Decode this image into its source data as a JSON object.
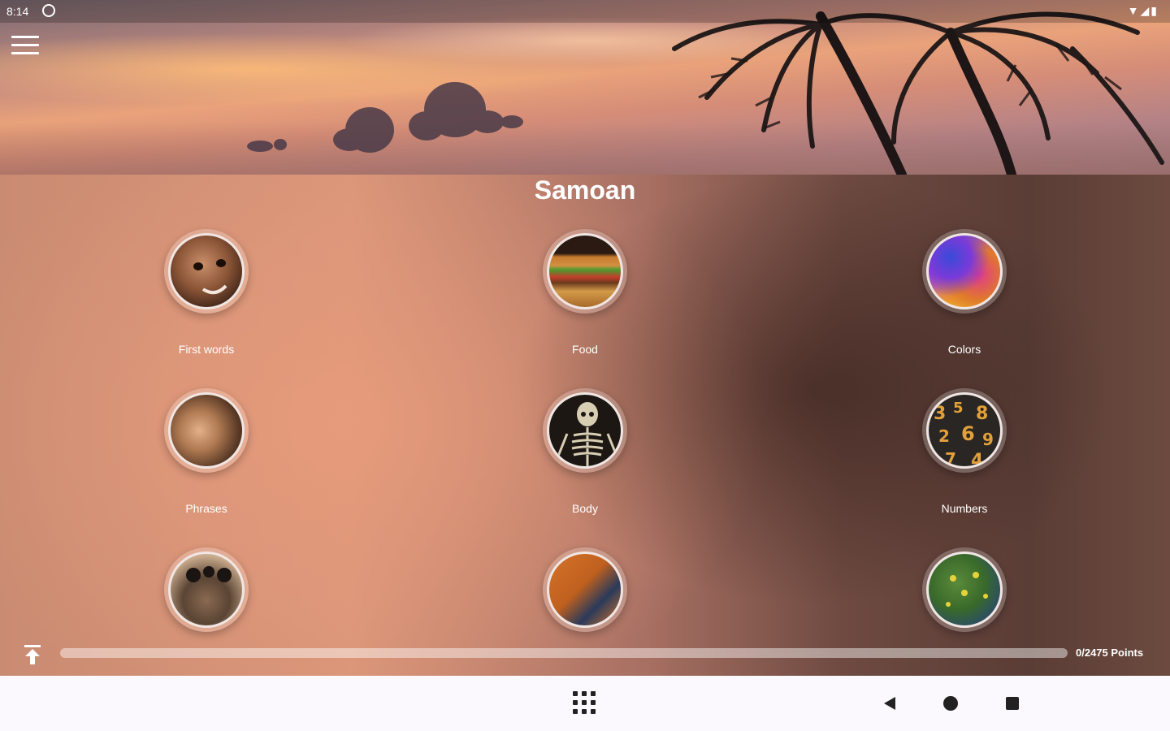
{
  "status_bar": {
    "time": "8:14",
    "icons": [
      "wifi-icon",
      "signal-icon",
      "battery-icon"
    ]
  },
  "header": {
    "menu_icon": "hamburger-menu-icon"
  },
  "title": "Samoan",
  "categories": [
    {
      "label": "First words",
      "icon": "baby-face-photo"
    },
    {
      "label": "Food",
      "icon": "burger-photo"
    },
    {
      "label": "Colors",
      "icon": "color-powder-photo"
    },
    {
      "label": "Phrases",
      "icon": "woman-photo"
    },
    {
      "label": "Body",
      "icon": "skeleton-photo"
    },
    {
      "label": "Numbers",
      "icon": "numbers-photo"
    },
    {
      "label": "",
      "icon": "alarm-clock-photo"
    },
    {
      "label": "",
      "icon": "shopping-cart-photo"
    },
    {
      "label": "",
      "icon": "lily-pads-photo"
    }
  ],
  "progress": {
    "points_label": "0/2475 Points",
    "fraction": 0.0
  },
  "nav_bar": {
    "icons": [
      "apps-grid-icon",
      "back-icon",
      "home-icon",
      "recents-icon"
    ]
  }
}
